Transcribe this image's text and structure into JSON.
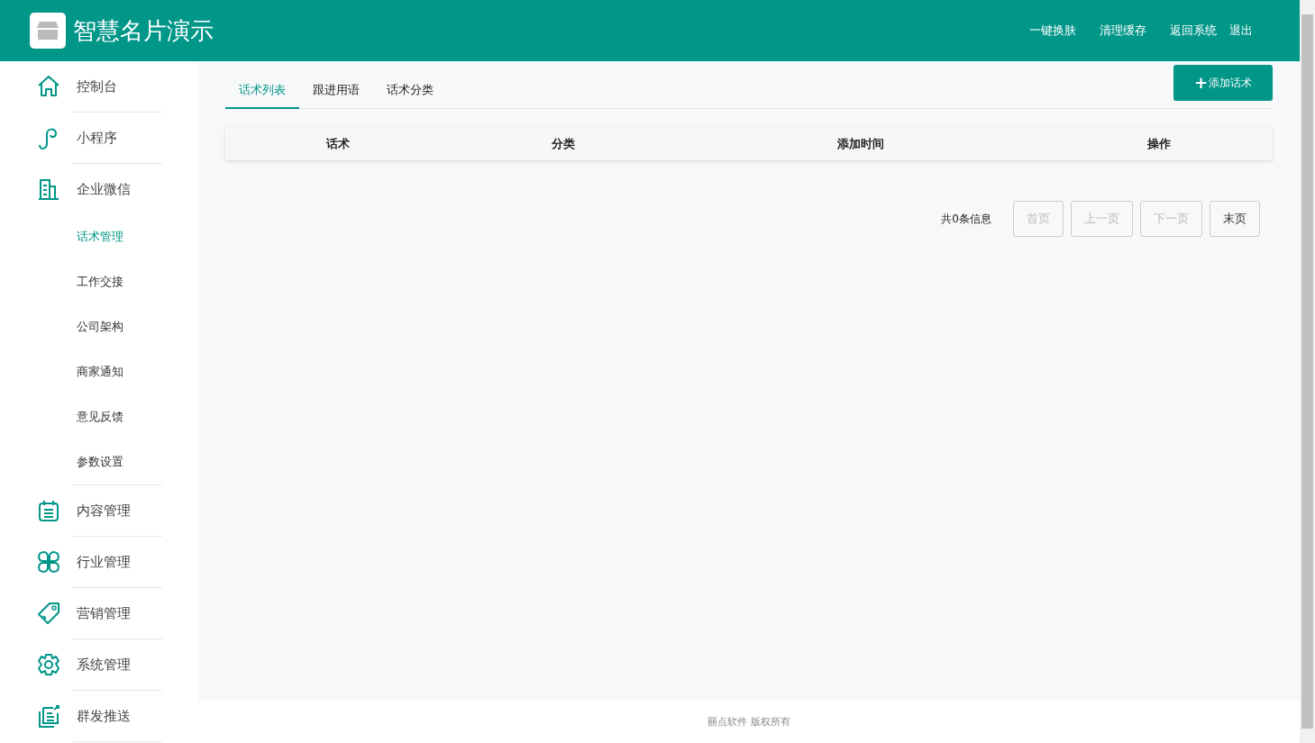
{
  "header": {
    "title": "智慧名片演示",
    "links": [
      "一键换肤",
      "清理缓存",
      "返回系统",
      "退出"
    ]
  },
  "sidebar": {
    "items": [
      {
        "label": "控制台"
      },
      {
        "label": "小程序"
      },
      {
        "label": "企业微信",
        "expanded": true,
        "children": [
          {
            "label": "话术管理",
            "selected": true
          },
          {
            "label": "工作交接",
            "selected": false
          },
          {
            "label": "公司架构",
            "selected": false
          },
          {
            "label": "商家通知",
            "selected": false
          },
          {
            "label": "意见反馈",
            "selected": false
          },
          {
            "label": "参数设置",
            "selected": false
          }
        ]
      },
      {
        "label": "内容管理"
      },
      {
        "label": "行业管理"
      },
      {
        "label": "营销管理"
      },
      {
        "label": "系统管理"
      },
      {
        "label": "群发推送"
      }
    ]
  },
  "tabs": [
    {
      "label": "话术列表",
      "selected": true
    },
    {
      "label": "跟进用语",
      "selected": false
    },
    {
      "label": "话术分类",
      "selected": false
    }
  ],
  "add_button": {
    "icon": "+",
    "label": "添加话术"
  },
  "table": {
    "columns": [
      "话术",
      "分类",
      "添加时间",
      "操作"
    ]
  },
  "pagination": {
    "total": "共0条信息",
    "buttons": [
      {
        "label": "首页",
        "disabled": true
      },
      {
        "label": "上一页",
        "disabled": true
      },
      {
        "label": "下一页",
        "disabled": true
      },
      {
        "label": "末页",
        "disabled": false
      }
    ]
  },
  "footer": {
    "text": "丽点软件 版权所有"
  }
}
